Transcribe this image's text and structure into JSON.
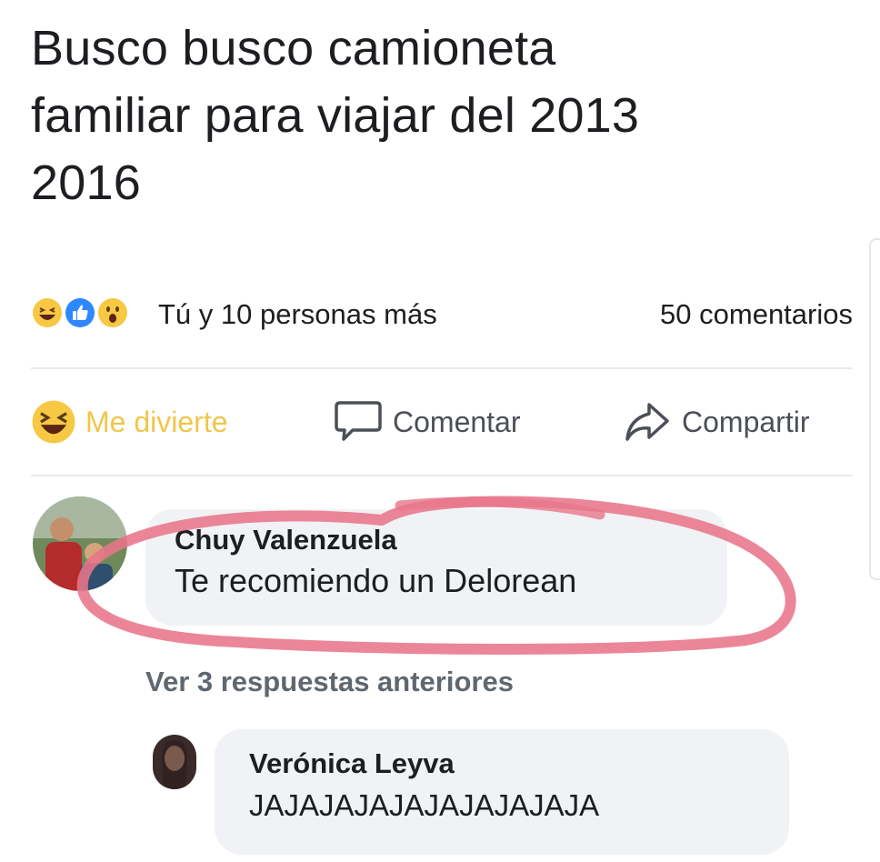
{
  "post": {
    "text_lines": [
      "Busco busco camioneta",
      "familiar para viajar del 2013",
      "2016"
    ]
  },
  "reactions": {
    "icons": [
      "laugh-emoji-icon",
      "like-icon",
      "wow-emoji-icon"
    ],
    "summary": "Tú y 10 personas más",
    "comments_count": "50 comentarios"
  },
  "actions": {
    "reaction_label": "Me divierte",
    "comment_label": "Comentar",
    "share_label": "Compartir"
  },
  "comment": {
    "author": "Chuy Valenzuela",
    "text": "Te recomiendo un Delorean"
  },
  "replies": {
    "view_more_label": "Ver 3 respuestas anteriores",
    "items": [
      {
        "author": "Verónica Leyva",
        "text": "JAJAJAJAJAJAJAJAJAJA"
      }
    ]
  },
  "colors": {
    "reaction_active": "#f0c64a",
    "annotation_circle": "#e8758a",
    "bubble_background": "#f0f2f5"
  }
}
